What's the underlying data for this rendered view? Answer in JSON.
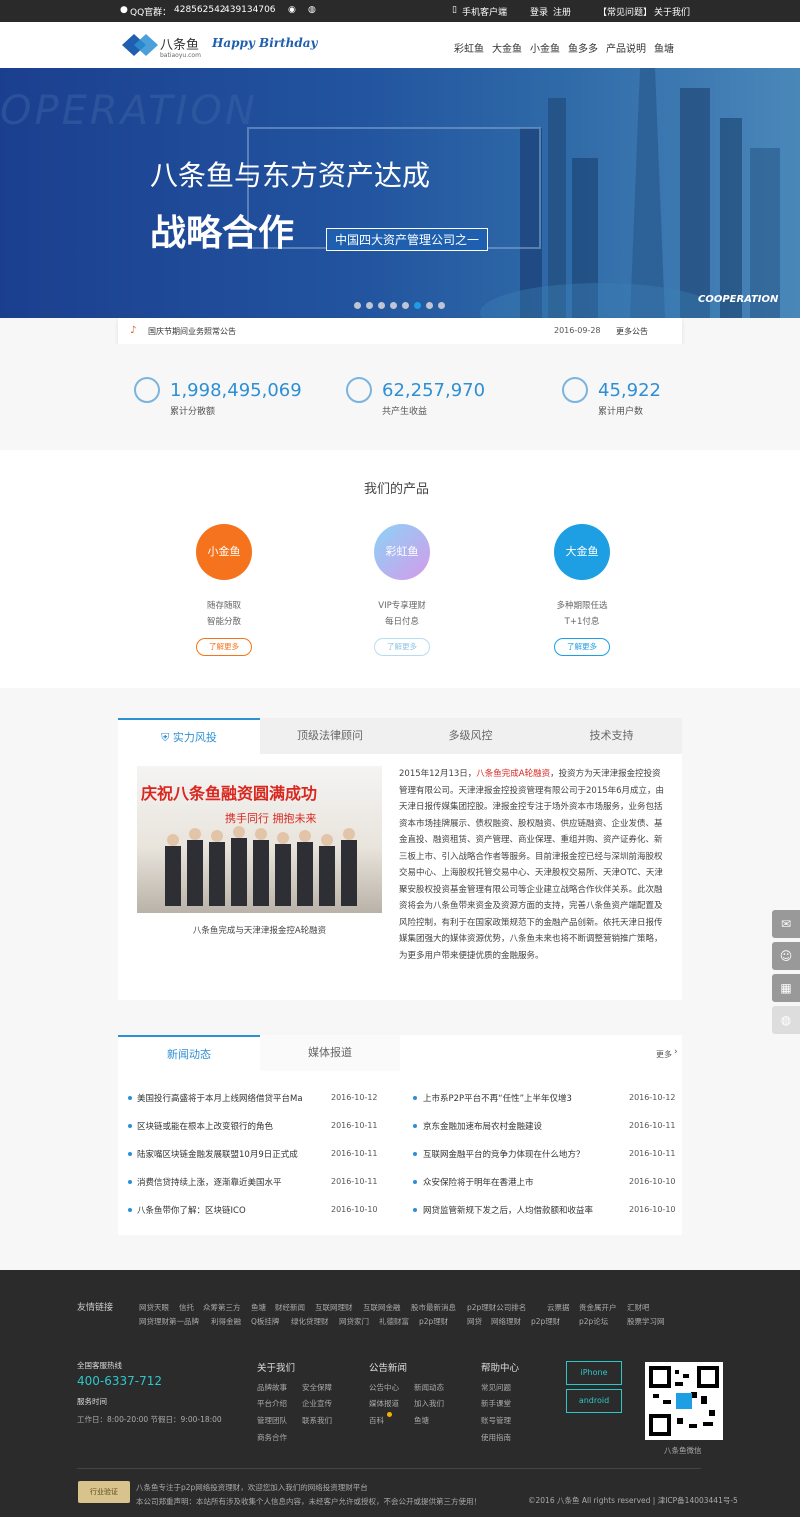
{
  "topbar": {
    "qq_label": "QQ官群：",
    "qq1": "428562542",
    "qq2": "439134706",
    "mobile": "手机客户端",
    "login": "登录",
    "register": "注册",
    "faq": "【常见问题】",
    "about": "关于我们"
  },
  "header": {
    "logo_text": "八条鱼",
    "logo_sub": "batiaoyu.com",
    "slogan": "Happy Birthday",
    "nav": [
      "彩虹鱼",
      "大金鱼",
      "小金鱼",
      "鱼多多",
      "产品说明",
      "鱼塘"
    ]
  },
  "banner": {
    "bg_text": "OPERATION",
    "headline1": "八条鱼与东方资产达成",
    "headline2": "战略合作",
    "tag": "中国四大资产管理公司之一",
    "corner": "COOPERATION",
    "dots": 8,
    "active_dot": 5
  },
  "notice": {
    "text": "国庆节期间业务照常公告",
    "date": "2016-09-28",
    "more": "更多公告"
  },
  "stats": [
    {
      "value": "1,998,495,069",
      "label": "累计分散额",
      "icon": "coin-stack-icon"
    },
    {
      "value": "62,257,970",
      "label": "共产生收益",
      "icon": "database-icon"
    },
    {
      "value": "45,922",
      "label": "累计用户数",
      "icon": "users-icon"
    }
  ],
  "products": {
    "title": "我们的产品",
    "items": [
      {
        "name": "小金鱼",
        "line1": "随存随取",
        "line2": "智能分散",
        "btn": "了解更多",
        "color": "#f5731c"
      },
      {
        "name": "彩虹鱼",
        "line1": "VIP专享理财",
        "line2": "每日付息",
        "btn": "了解更多",
        "color": "#b8a3ec"
      },
      {
        "name": "大金鱼",
        "line1": "多种期限任选",
        "line2": "T+1付息",
        "btn": "了解更多",
        "color": "#1e9fe3"
      }
    ]
  },
  "tabs": {
    "labels": [
      "实力风投",
      "顶级法律顾问",
      "多级风控",
      "技术支持"
    ],
    "image_banner": "庆祝八条鱼融资圆满成功",
    "image_sub": "携手同行  拥抱未来",
    "caption": "八条鱼完成与天津津报金控A轮融资",
    "para_date": "2015年12月13日，",
    "para_highlight": "八条鱼完成A轮融资",
    "para_rest": "，投资方为天津津报金控投资管理有限公司。天津津报金控投资管理有限公司于2015年6月成立，由天津日报传媒集团控股。津报金控专注于场外资本市场服务，业务包括资本市场挂牌展示、债权融资、股权融资、供应链融资、企业发债、基金直投、融资租赁、资产管理、商业保理、重组并购、资产证券化、新三板上市、引入战略合作者等服务。目前津报金控已经与深圳前海股权交易中心、上海股权托管交易中心、天津股权交易所、天津OTC、天津聚安股权投资基金管理有限公司等企业建立战略合作伙伴关系。此次融资将会为八条鱼带来资金及资源方面的支持，完善八条鱼资产端配置及风险控制，有利于在国家政策规范下的金融产品创新。依托天津日报传媒集团强大的媒体资源优势，八条鱼未来也将不断调整营销推广策略，为更多用户带来便捷优质的金融服务。"
  },
  "news": {
    "tabs": [
      "新闻动态",
      "媒体报道"
    ],
    "more": "更多",
    "left": [
      {
        "title": "美国投行高盛将于本月上线网络借贷平台Ma",
        "date": "2016-10-12"
      },
      {
        "title": "区块链或能在根本上改变银行的角色",
        "date": "2016-10-11"
      },
      {
        "title": "陆家嘴区块链金融发展联盟10月9日正式成",
        "date": "2016-10-11"
      },
      {
        "title": "消费信贷持续上涨，逐渐靠近美国水平",
        "date": "2016-10-11"
      },
      {
        "title": "八条鱼带你了解：区块链ICO",
        "date": "2016-10-10"
      }
    ],
    "right": [
      {
        "title": "上市系P2P平台不再“任性”上半年仅增3",
        "date": "2016-10-12"
      },
      {
        "title": "京东金融加速布局农村金融建设",
        "date": "2016-10-11"
      },
      {
        "title": "互联网金融平台的竞争力体现在什么地方？",
        "date": "2016-10-11"
      },
      {
        "title": "众安保险将于明年在香港上市",
        "date": "2016-10-10"
      },
      {
        "title": "网贷监管新规下发之后，人均借款额和收益率",
        "date": "2016-10-10"
      }
    ]
  },
  "footer": {
    "links_title": "友情链接",
    "links_row1": [
      "网贷天眼",
      "信托",
      "众筹第三方",
      "鱼塘",
      "财经新闻",
      "互联网理财",
      "互联网金融",
      "股市最新消息",
      "p2p理财公司排名",
      "云票据",
      "贵金属开户",
      "汇财吧"
    ],
    "links_row2": [
      "网贷理财第一品牌",
      "利得金融",
      "Q板挂牌",
      "绿化贷理财",
      "网贷家门",
      "礼德财富",
      "p2p理财",
      "网贷",
      "网络理财",
      "p2p理财",
      "p2p论坛",
      "股票学习网"
    ],
    "hotline_label": "全国客服热线",
    "hotline": "400-6337-712",
    "service_label": "服务时间",
    "service_time": "工作日：8:00-20:00  节假日：9:00-18:00",
    "cols": [
      {
        "title": "关于我们",
        "items": [
          "品牌故事",
          "安全保障",
          "平台介绍",
          "企业宣传",
          "管理团队",
          "联系我们",
          "商务合作"
        ]
      },
      {
        "title": "公告新闻",
        "items": [
          "公告中心",
          "新闻动态",
          "媒体报道",
          "加入我们",
          "百科",
          "鱼塘"
        ]
      },
      {
        "title": "帮助中心",
        "items": [
          "常见问题",
          "新手课堂",
          "账号管理",
          "使用指南"
        ]
      }
    ],
    "app_iphone": "iPhone",
    "app_android": "android",
    "qr_label": "八条鱼微信",
    "badge": "行业验证",
    "disclaimer1": "八条鱼专注于p2p网络投资理财，欢迎您加入我们的网络投资理财平台",
    "disclaimer2": "本公司郑重声明：本站所有涉及收集个人信息内容，未经客户允许或授权，不会公开或提供第三方使用！",
    "copyright": "©2016 八条鱼 All rights reserved | 津ICP备14003441号-5"
  },
  "colors": {
    "accent": "#2d8fd4",
    "orange": "#f5731c",
    "dark": "#2b2b2b"
  }
}
